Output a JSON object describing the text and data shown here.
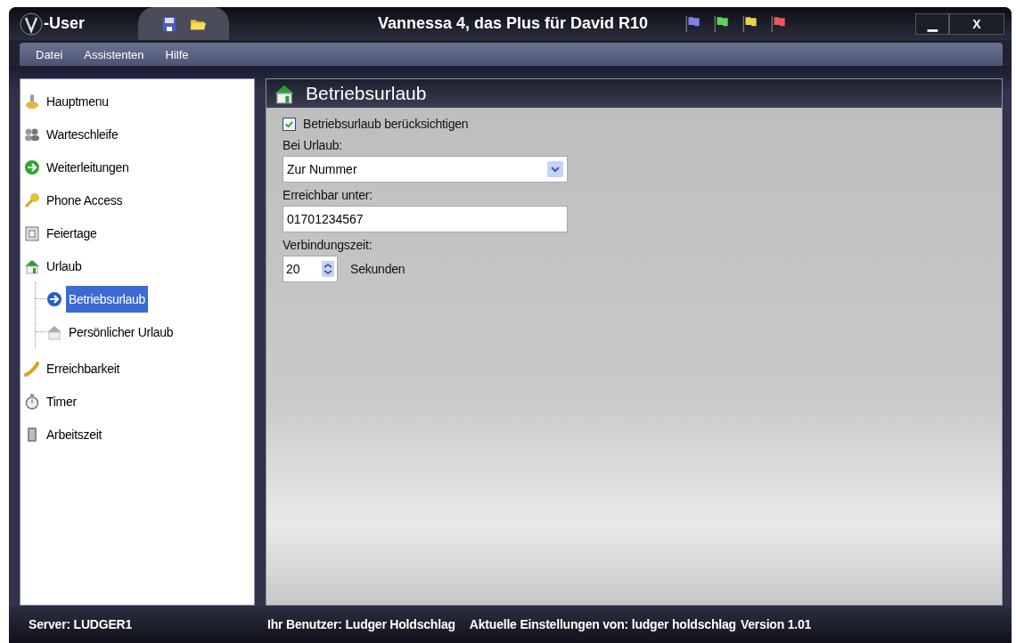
{
  "window": {
    "app_label": "-User",
    "title": "Vannessa 4, das Plus für David R10",
    "flags": [
      {
        "color": "#7f7fe8"
      },
      {
        "color": "#5ed15e"
      },
      {
        "color": "#e8d44a"
      },
      {
        "color": "#e85a5a"
      }
    ],
    "minimize": "▁",
    "close": "X"
  },
  "menu": [
    "Datei",
    "Assistenten",
    "Hilfe"
  ],
  "sidebar": {
    "items": [
      {
        "label": "Hauptmenu",
        "selected": false
      },
      {
        "label": "Warteschleife",
        "selected": false
      },
      {
        "label": "Weiterleitungen",
        "selected": false
      },
      {
        "label": "Phone Access",
        "selected": false
      },
      {
        "label": "Feiertage",
        "selected": false
      },
      {
        "label": "Urlaub",
        "selected": false,
        "children": [
          {
            "label": "Betriebsurlaub",
            "selected": true
          },
          {
            "label": "Persönlicher Urlaub",
            "selected": false
          }
        ]
      },
      {
        "label": "Erreichbarkeit",
        "selected": false
      },
      {
        "label": "Timer",
        "selected": false
      },
      {
        "label": "Arbeitszeit",
        "selected": false
      }
    ]
  },
  "panel": {
    "title": "Betriebsurlaub",
    "checkbox": {
      "label": "Betriebsurlaub berücksichtigen",
      "checked": true
    },
    "dropdown": {
      "label": "Bei Urlaub:",
      "value": "Zur Nummer"
    },
    "number_field": {
      "label": "Erreichbar unter:",
      "value": "01701234567"
    },
    "spinner": {
      "label": "Verbindungszeit:",
      "value": "20",
      "unit": "Sekunden"
    }
  },
  "status_bar": {
    "server": "Server: LUDGER1",
    "user": "Ihr Benutzer: Ludger Holdschlag",
    "settings": "Aktuelle Einstellungen von: ludger holdschlag",
    "version": "Version 1.01"
  }
}
